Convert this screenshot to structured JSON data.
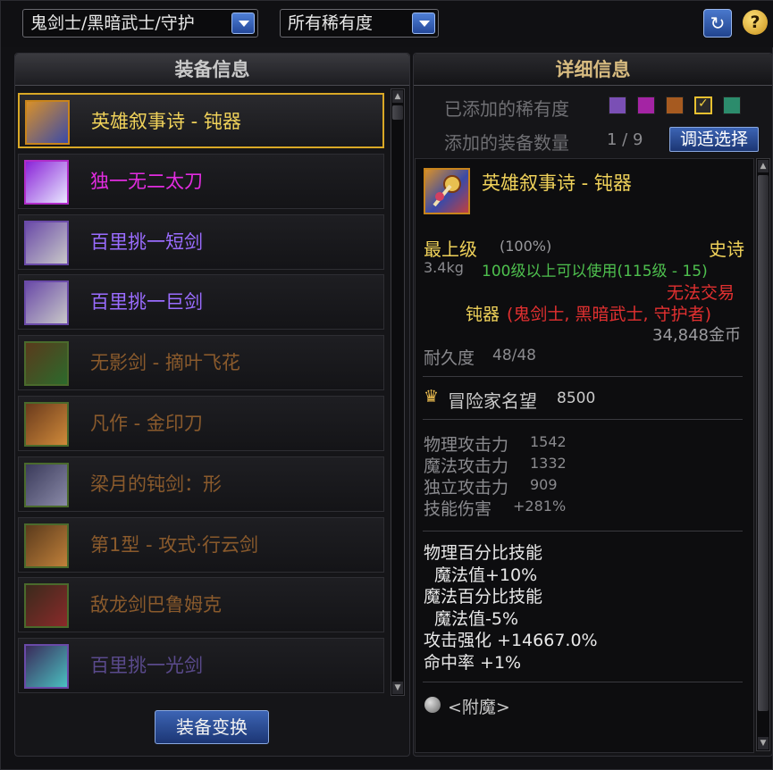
{
  "filters": {
    "job": "鬼剑士/黑暗武士/守护",
    "rarity": "所有稀有度"
  },
  "left_panel": {
    "title": "装备信息",
    "items": [
      {
        "name": "英雄叙事诗 - 钝器",
        "color": "#f0d25a",
        "selected": true
      },
      {
        "name": "独一无二太刀",
        "color": "#e22ce0",
        "selected": false
      },
      {
        "name": "百里挑一短剑",
        "color": "#9a6cff",
        "selected": false
      },
      {
        "name": "百里挑一巨剑",
        "color": "#9a6cff",
        "selected": false
      },
      {
        "name": "无影剑 - 摘叶飞花",
        "color": "#8a5a2c",
        "selected": false
      },
      {
        "name": "凡作 - 金印刀",
        "color": "#8a5a2c",
        "selected": false
      },
      {
        "name": "梁月的钝剑：形",
        "color": "#8a5a2c",
        "selected": false
      },
      {
        "name": "第1型 - 攻式·行云剑",
        "color": "#8a5a2c",
        "selected": false
      },
      {
        "name": "敌龙剑巴鲁姆克",
        "color": "#8a5a2c",
        "selected": false
      },
      {
        "name": "百里挑一光剑",
        "color": "#5a4a8c",
        "selected": false
      }
    ],
    "swap_button": "装备变换"
  },
  "right_panel": {
    "title": "详细信息",
    "rarity_label": "已添加的稀有度",
    "rarity_swatches": [
      "#7a4fb5",
      "#a424a4",
      "#a65a20",
      "#2a2a2a",
      "#2c8c6c"
    ],
    "count_label": "添加的装备数量",
    "count_value": "1 / 9",
    "adjust_button": "调适选择",
    "item": {
      "name": "英雄叙事诗 - 钝器",
      "grade": "最上级",
      "grade_pct": "(100%)",
      "rarity": "史诗",
      "weight": "3.4kg",
      "level_req": "100级以上可以使用(115级 - 15)",
      "trade": "无法交易",
      "type_prefix": "钝器",
      "type_jobs": "(鬼剑士, 黑暗武士, 守护者)",
      "price": "34,848金币",
      "durability_label": "耐久度",
      "durability": "48/48",
      "reputation_label": "冒险家名望",
      "reputation": "8500",
      "stats": [
        {
          "label": "物理攻击力",
          "value": "1542"
        },
        {
          "label": "魔法攻击力",
          "value": "1332"
        },
        {
          "label": "独立攻击力",
          "value": "909"
        },
        {
          "label": "技能伤害",
          "value": "+281%"
        }
      ],
      "bonuses": [
        "物理百分比技能",
        "魔法值+10%",
        "魔法百分比技能",
        "魔法值-5%",
        "攻击强化 +14667.0%",
        "命中率 +1%"
      ],
      "enchant": "<附魔>"
    }
  }
}
